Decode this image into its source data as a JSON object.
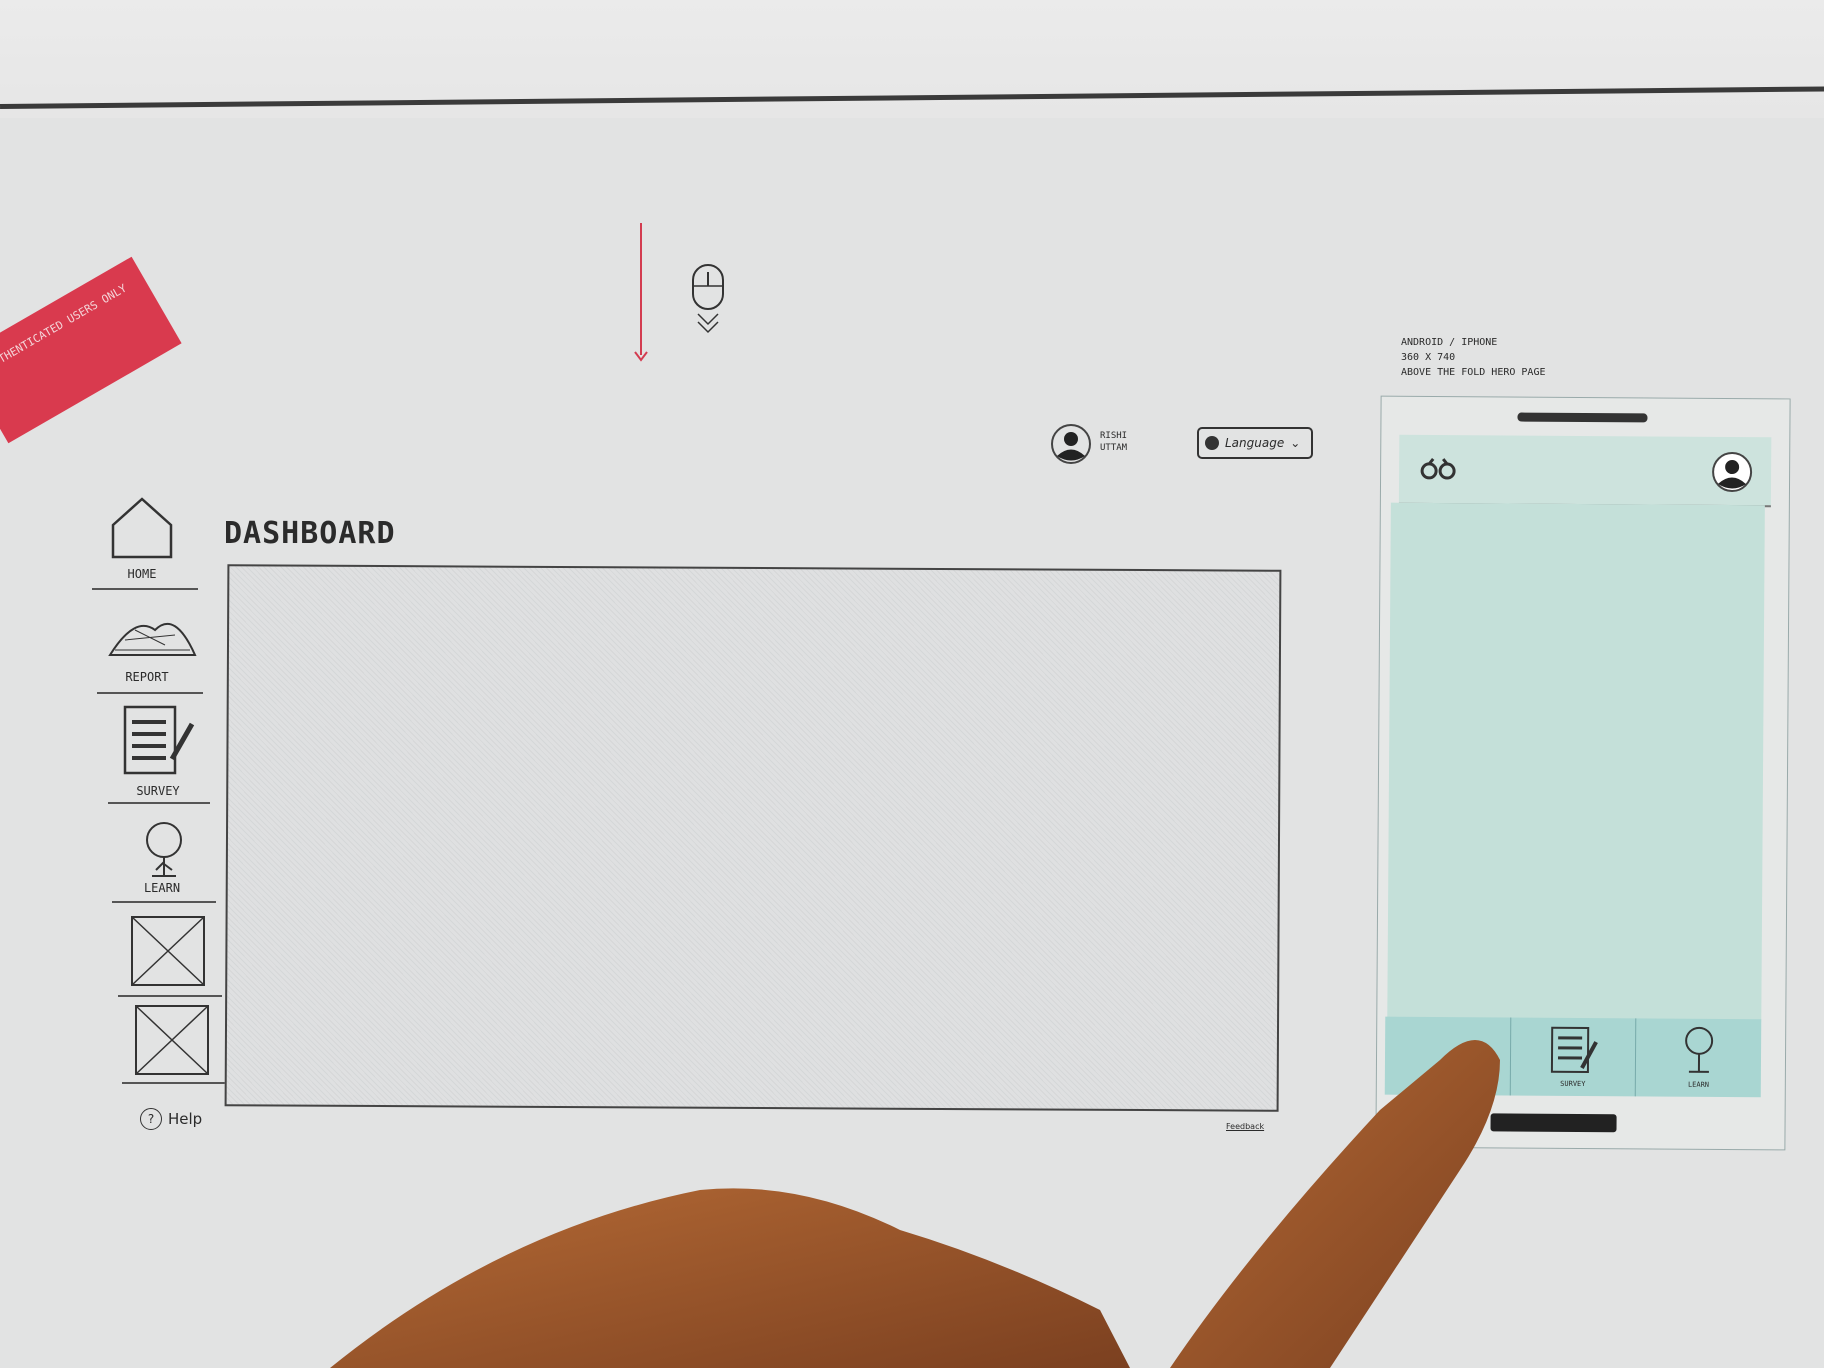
{
  "banner": {
    "text": "AUTHENTICATED USERS ONLY",
    "color": "#d93a4e"
  },
  "header": {
    "user_name": "RISHI UTTAM",
    "language_label": "Language",
    "language_icon": "globe-icon"
  },
  "page_title": "DASHBOARD",
  "sidebar": {
    "items": [
      {
        "label": "HOME",
        "icon": "house-icon"
      },
      {
        "label": "REPORT",
        "icon": "tree-sketch-icon"
      },
      {
        "label": "SURVEY",
        "icon": "checklist-icon"
      },
      {
        "label": "LEARN",
        "icon": "tree-icon"
      },
      {
        "label": "",
        "icon": "image-placeholder-icon"
      },
      {
        "label": "",
        "icon": "image-placeholder-icon"
      }
    ],
    "help_label": "Help"
  },
  "footer": {
    "feedback": "Feedback"
  },
  "mobile": {
    "annotation": [
      "ANDROID / IPHONE",
      "360 X 740",
      "ABOVE THE FOLD HERO PAGE"
    ],
    "nav": [
      {
        "label": "",
        "icon": "home-icon"
      },
      {
        "label": "SURVEY",
        "icon": "checklist-icon"
      },
      {
        "label": "LEARN",
        "icon": "tree-icon"
      }
    ],
    "colors": {
      "content": "#c4e0d9",
      "nav": "#a9d6d2"
    }
  }
}
